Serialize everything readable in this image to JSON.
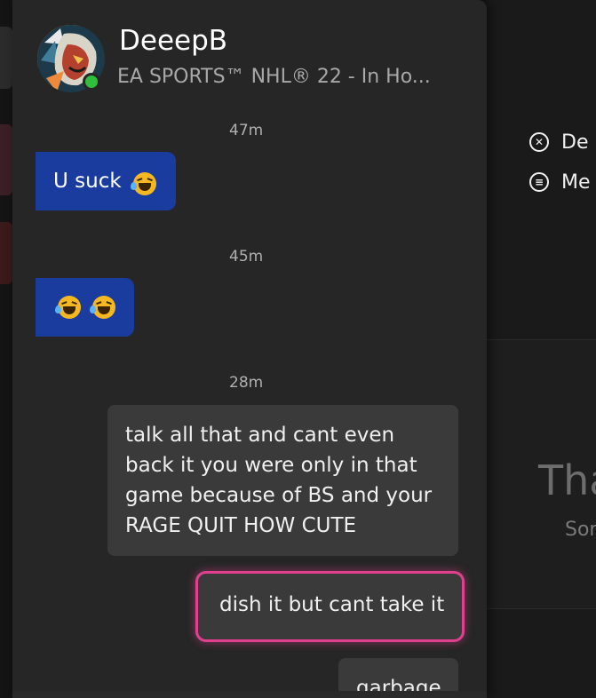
{
  "header": {
    "gamertag": "DeeepB",
    "status": "EA SPORTS™ NHL® 22 - In Ho...",
    "presence_color": "#2fbf3c"
  },
  "messages": [
    {
      "timestamp": "47m",
      "direction": "incoming",
      "text": "U suck",
      "emoji": [
        "rolling-on-floor-laughing"
      ]
    },
    {
      "timestamp": "45m",
      "direction": "incoming",
      "text": "",
      "emoji": [
        "rolling-on-floor-laughing",
        "rolling-on-floor-laughing"
      ]
    },
    {
      "timestamp": "28m",
      "direction": "outgoing",
      "text": "talk all that and cant even back it you were only in that game because of BS and your RAGE QUIT HOW CUTE"
    },
    {
      "direction": "outgoing",
      "text": "dish it but cant take it",
      "focused": true
    },
    {
      "direction": "outgoing",
      "text": "garbage"
    }
  ],
  "background": {
    "menu": [
      {
        "icon": "x-circle-icon",
        "label": "De"
      },
      {
        "icon": "menu-circle-icon",
        "label": "Me"
      }
    ],
    "big_text": "Tha",
    "small_text": "Sor"
  },
  "colors": {
    "incoming_bubble": "#1a3c9e",
    "outgoing_bubble": "#3a3a3a",
    "focus_ring": "#e0408e",
    "panel": "#262626"
  }
}
